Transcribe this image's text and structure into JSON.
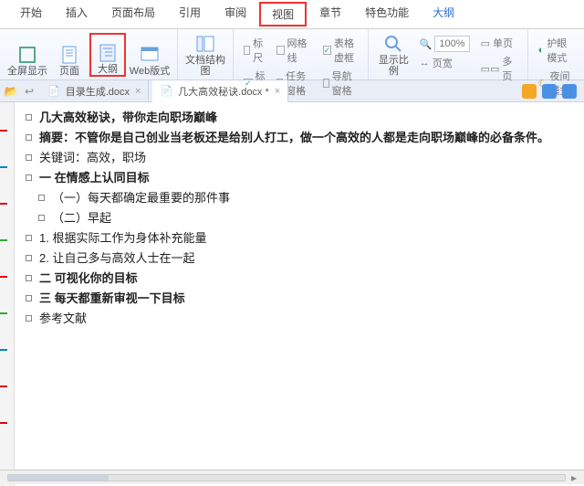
{
  "menu": {
    "items": [
      {
        "label": "开始"
      },
      {
        "label": "插入"
      },
      {
        "label": "页面布局"
      },
      {
        "label": "引用"
      },
      {
        "label": "审阅"
      },
      {
        "label": "视图",
        "hl": true
      },
      {
        "label": "章节"
      },
      {
        "label": "特色功能"
      },
      {
        "label": "大纲",
        "active": true
      }
    ]
  },
  "ribbon": {
    "g1": {
      "full": "全屏显示",
      "page": "页面",
      "outline": "大纲",
      "web": "Web版式"
    },
    "g2": {
      "docmap": "文档结构图"
    },
    "g3": {
      "ruler": "标尺",
      "grid": "网格线",
      "mark": "标记",
      "taskpane": "任务窗格",
      "tablevis": "表格虚框",
      "nav": "导航窗格"
    },
    "g4": {
      "zoom": "显示比例",
      "zoomval": "100%",
      "fitw": "页宽",
      "single": "单页",
      "multi": "多页"
    },
    "g5": {
      "eye": "护眼模式",
      "night": "夜间模式"
    }
  },
  "tabs": {
    "doc1": {
      "name": "目录生成.docx"
    },
    "doc2": {
      "name": "几大高效秘诀.docx *"
    }
  },
  "outline": {
    "lines": [
      {
        "t": "几大高效秘诀，带你走向职场巅峰",
        "b": true
      },
      {
        "t": "摘要：不管你是自己创业当老板还是给别人打工，做一个高效的人都是走向职场巅峰的必备条件。",
        "b": true,
        "wrap": true
      },
      {
        "t": "关键词：高效，职场"
      },
      {
        "t": "一  在情感上认同目标",
        "b": true
      },
      {
        "t": "（一）每天都确定最重要的那件事",
        "i": 1
      },
      {
        "t": "（二）早起",
        "i": 1
      },
      {
        "t": "1. 根据实际工作为身体补充能量"
      },
      {
        "t": "2. 让自己多与高效人士在一起"
      },
      {
        "t": "二  可视化你的目标",
        "b": true
      },
      {
        "t": "三  每天都重新审视一下目标",
        "b": true
      },
      {
        "t": "参考文献"
      }
    ]
  }
}
